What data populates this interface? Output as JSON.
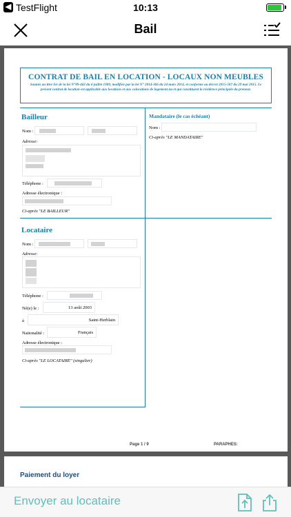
{
  "status_bar": {
    "back_app": "TestFlight",
    "time": "10:13",
    "battery_level": 0.9,
    "battery_color": "#2ec43c"
  },
  "nav": {
    "title": "Bail",
    "close_icon": "close-icon",
    "list_icon": "checklist-icon"
  },
  "document": {
    "header": {
      "title": "CONTRAT DE BAIL EN LOCATION - LOCAUX NON MEUBLES",
      "subtitle": "Soumis au titre Ier de la loi N°89-462 du 6 juillet 1989, modifiée par la loi N° 2014-366 du 24 mars 2014, et conforme au décret 2015-587 du 29 mai 2015. Le présent contrat de location est applicable aux locations et aux colocations de logement nu et qui constituent la résidence principale du preneur."
    },
    "bailleur": {
      "title": "Bailleur",
      "nom_label": "Nom :",
      "adresse_label": "Adresse:",
      "telephone_label": "Téléphone :",
      "email_label": "Adresse électronique :",
      "note": "Ci-après \"LE BAILLEUR\""
    },
    "mandataire": {
      "title": "Mandataire (le cas échéant)",
      "nom_label": "Nom :",
      "note": "Ci-après \"LE MANDATAIRE\""
    },
    "locataire": {
      "title": "Locataire",
      "nom_label": "Nom :",
      "adresse_label": "Adresse:",
      "telephone_label": "Téléphone :",
      "birth_label": "Né(e) le :",
      "birth_date": "13 août 2003",
      "birth_place_label": "à",
      "birth_place": "Saint-Herblain",
      "nationality_label": "Nationalité :",
      "nationality": "Français",
      "email_label": "Adresse électronique :",
      "note": "Ci-après \"LE LOCATAIRE\" (singulier)"
    },
    "footer": {
      "page": "Page 1 / 9",
      "paraphes": "PARAPHES:"
    },
    "page2_title": "Paiement du loyer",
    "accent_color": "#1a7fa8"
  },
  "toolbar": {
    "send_label": "Envoyer au locataire",
    "accent_color": "#5cc0b9",
    "export_icon": "document-upload-icon",
    "share_icon": "share-icon"
  }
}
